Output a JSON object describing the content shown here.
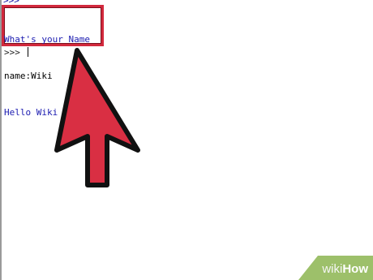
{
  "console": {
    "lines": [
      {
        "text": "What's your Name",
        "kind": "output"
      },
      {
        "text": "name:Wiki",
        "kind": "input"
      },
      {
        "text": "Hello Wiki",
        "kind": "output"
      }
    ],
    "prompt": ">>> "
  },
  "annotation": {
    "arrow_color": "#d92f43",
    "box_color": "#d2293d",
    "arrow_icon": "pointer-arrow-icon"
  },
  "watermark": {
    "part1": "wiki",
    "part2": "How",
    "bg_color": "#9dc06a"
  }
}
